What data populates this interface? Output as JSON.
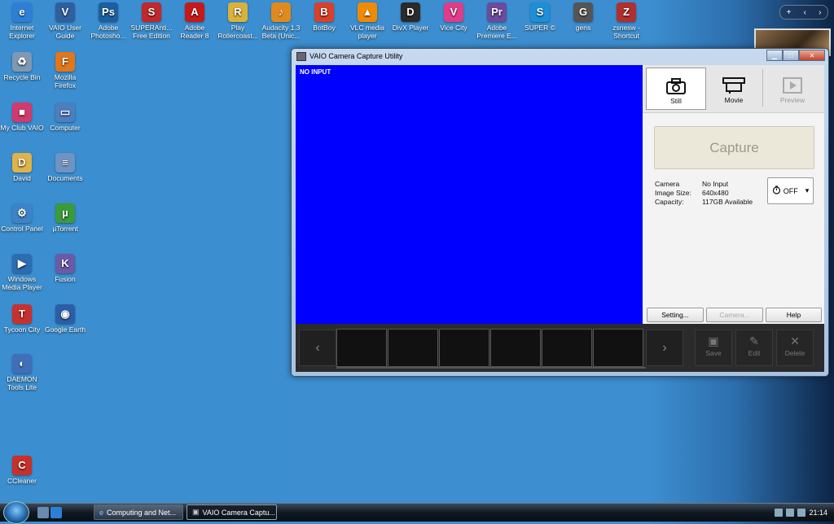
{
  "desktop": {
    "top_icons": [
      {
        "label": "Internet Explorer",
        "glyph": "e",
        "color": "#2d7fd6"
      },
      {
        "label": "VAIO User Guide",
        "glyph": "V",
        "color": "#2f5f9f"
      },
      {
        "label": "Adobe Photosho...",
        "glyph": "Ps",
        "color": "#1b5fa0"
      },
      {
        "label": "SUPERAnti... Free Edition",
        "glyph": "S",
        "color": "#c0282a"
      },
      {
        "label": "Adobe Reader 8",
        "glyph": "A",
        "color": "#c41a1a"
      },
      {
        "label": "Play Rollercoast...",
        "glyph": "R",
        "color": "#d9b23a"
      },
      {
        "label": "Audacity 1.3 Beta (Unic...",
        "glyph": "♪",
        "color": "#e08a1e"
      },
      {
        "label": "BotBoy",
        "glyph": "B",
        "color": "#d8402a"
      },
      {
        "label": "VLC media player",
        "glyph": "▲",
        "color": "#f08a00"
      },
      {
        "label": "DivX Player",
        "glyph": "D",
        "color": "#2a2a2a"
      },
      {
        "label": "Vice City",
        "glyph": "V",
        "color": "#e03c8a"
      },
      {
        "label": "Adobe Premiere E...",
        "glyph": "Pr",
        "color": "#6b4aa0"
      },
      {
        "label": "SUPER ©",
        "glyph": "S",
        "color": "#1c8fd8"
      },
      {
        "label": "gens",
        "glyph": "G",
        "color": "#555555"
      },
      {
        "label": "zsnesw - Shortcut",
        "glyph": "Z",
        "color": "#b03030"
      }
    ],
    "left_icons": [
      {
        "label": "Recycle Bin",
        "glyph": "♻",
        "color": "#7f98b5"
      },
      {
        "label": "Mozilla Firefox",
        "glyph": "F",
        "color": "#e2761b"
      },
      {
        "label": "My Club VAIO",
        "glyph": "■",
        "color": "#d23a6e"
      },
      {
        "label": "Computer",
        "glyph": "▭",
        "color": "#4b7fc0"
      },
      {
        "label": "David",
        "glyph": "D",
        "color": "#e0b24a"
      },
      {
        "label": "Documents",
        "glyph": "≡",
        "color": "#6f93c3"
      },
      {
        "label": "Control Panel",
        "glyph": "⚙",
        "color": "#3c84c8"
      },
      {
        "label": "µTorrent",
        "glyph": "µ",
        "color": "#3a9b3a"
      },
      {
        "label": "Windows Media Player",
        "glyph": "▶",
        "color": "#2c6cb0"
      },
      {
        "label": "Fusion",
        "glyph": "K",
        "color": "#6a5aa8"
      },
      {
        "label": "Tycoon City",
        "glyph": "T",
        "color": "#c83030"
      },
      {
        "label": "Google Earth",
        "glyph": "◉",
        "color": "#2a5fa8"
      },
      {
        "label": "DAEMON Tools Lite",
        "glyph": "◐",
        "color": "#3f6fb8"
      },
      {
        "label": "CCleaner",
        "glyph": "C",
        "color": "#c8302a"
      }
    ]
  },
  "gadget": {
    "plus": "+",
    "prev": "‹",
    "next": "›"
  },
  "window": {
    "title": "VAIO Camera Capture Utility",
    "controls": {
      "minimize": "▁",
      "maximize": "□",
      "close": "✕"
    },
    "video_status": "NO INPUT",
    "modes": [
      {
        "label": "Still",
        "state": "active"
      },
      {
        "label": "Movie",
        "state": "normal"
      },
      {
        "label": "Preview",
        "state": "disabled"
      }
    ],
    "capture_label": "Capture",
    "info": {
      "camera_label": "Camera",
      "camera_value": "No Input",
      "size_label": "Image Size:",
      "size_value": "640x480",
      "capacity_label": "Capacity:",
      "capacity_value": "117GB Available"
    },
    "timer": {
      "icon": "timer-icon",
      "value": "OFF",
      "arrow": "▾"
    },
    "buttons": {
      "setting": "Setting...",
      "camera": "Camera...",
      "help": "Help"
    },
    "strip": {
      "prev": "‹",
      "next": "›",
      "save": "Save",
      "edit": "Edit",
      "delete": "Delete"
    }
  },
  "taskbar": {
    "tasks": [
      {
        "label": "Computing and Net...",
        "state": "normal"
      },
      {
        "label": "VAIO Camera Captu...",
        "state": "active"
      }
    ],
    "clock": "21:14"
  }
}
